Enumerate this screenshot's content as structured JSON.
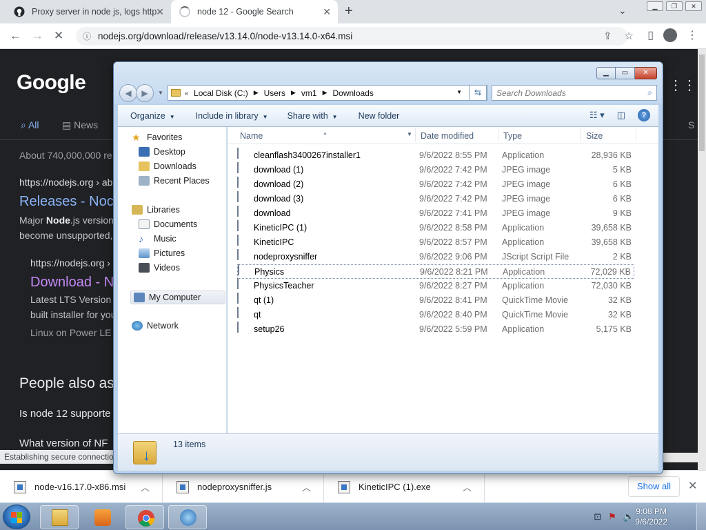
{
  "browser": {
    "tabs": [
      {
        "title": "Proxy server in node js, logs http"
      },
      {
        "title": "node 12 - Google Search"
      }
    ],
    "url": "nodejs.org/download/release/v13.14.0/node-v13.14.0-x64.msi"
  },
  "google": {
    "logo": "Google",
    "tab_all": "All",
    "tab_news": "News",
    "tab_s": "S",
    "about": "About 740,000,000 re",
    "r1_cite": "https://nodejs.org › ab",
    "r1_title": "Releases - Noc",
    "r1_s1": "Major Node.js version",
    "r1_s1_bold": "Node",
    "r1_s2": "become unsupported,",
    "r2_cite": "https://nodejs.org ›",
    "r2_title": "Download - N",
    "r2_s1": "Latest LTS Version",
    "r2_s2": "built installer for you",
    "r2_s3": "Linux on Power LE",
    "paa": "People also as",
    "q1": "Is node 12 supporte",
    "q2": "What version of NF",
    "status": "Establishing secure connectio"
  },
  "explorer": {
    "address": {
      "root": "Local Disk (C:)",
      "p1": "Users",
      "p2": "vm1",
      "p3": "Downloads"
    },
    "search_placeholder": "Search Downloads",
    "cmd": {
      "organize": "Organize",
      "include": "Include in library",
      "share": "Share with",
      "newfolder": "New folder"
    },
    "nav": {
      "favorites": "Favorites",
      "desktop": "Desktop",
      "downloads": "Downloads",
      "recent": "Recent Places",
      "libraries": "Libraries",
      "documents": "Documents",
      "music": "Music",
      "pictures": "Pictures",
      "videos": "Videos",
      "computer": "My Computer",
      "network": "Network"
    },
    "columns": {
      "name": "Name",
      "date": "Date modified",
      "type": "Type",
      "size": "Size"
    },
    "files": [
      {
        "name": "cleanflash3400267installer1",
        "date": "9/6/2022 8:55 PM",
        "type": "Application",
        "size": "28,936 KB"
      },
      {
        "name": "download (1)",
        "date": "9/6/2022 7:42 PM",
        "type": "JPEG image",
        "size": "5 KB"
      },
      {
        "name": "download (2)",
        "date": "9/6/2022 7:42 PM",
        "type": "JPEG image",
        "size": "6 KB"
      },
      {
        "name": "download (3)",
        "date": "9/6/2022 7:42 PM",
        "type": "JPEG image",
        "size": "6 KB"
      },
      {
        "name": "download",
        "date": "9/6/2022 7:41 PM",
        "type": "JPEG image",
        "size": "9 KB"
      },
      {
        "name": "KineticIPC (1)",
        "date": "9/6/2022 8:58 PM",
        "type": "Application",
        "size": "39,658 KB"
      },
      {
        "name": "KineticIPC",
        "date": "9/6/2022 8:57 PM",
        "type": "Application",
        "size": "39,658 KB"
      },
      {
        "name": "nodeproxysniffer",
        "date": "9/6/2022 9:06 PM",
        "type": "JScript Script File",
        "size": "2 KB"
      },
      {
        "name": "Physics",
        "date": "9/6/2022 8:21 PM",
        "type": "Application",
        "size": "72,029 KB"
      },
      {
        "name": "PhysicsTeacher",
        "date": "9/6/2022 8:27 PM",
        "type": "Application",
        "size": "72,030 KB"
      },
      {
        "name": "qt (1)",
        "date": "9/6/2022 8:41 PM",
        "type": "QuickTime Movie",
        "size": "32 KB"
      },
      {
        "name": "qt",
        "date": "9/6/2022 8:40 PM",
        "type": "QuickTime Movie",
        "size": "32 KB"
      },
      {
        "name": "setup26",
        "date": "9/6/2022 5:59 PM",
        "type": "Application",
        "size": "5,175 KB"
      }
    ],
    "item_count": "13 items"
  },
  "downloads": {
    "items": [
      {
        "name": "node-v16.17.0-x86.msi"
      },
      {
        "name": "nodeproxysniffer.js"
      },
      {
        "name": "KineticIPC (1).exe"
      }
    ],
    "show_all": "Show all"
  },
  "taskbar": {
    "time": "9:08 PM",
    "date": "9/6/2022"
  },
  "colors": {
    "chrome_tab": "#dee1e6",
    "google_bg": "#202124",
    "link": "#8ab4f8",
    "visited": "#c58af9"
  }
}
